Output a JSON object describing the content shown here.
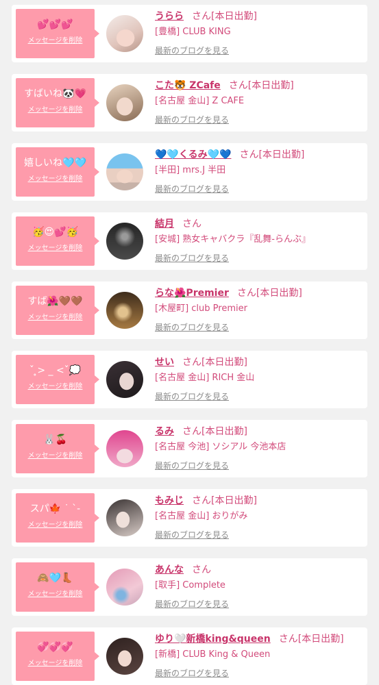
{
  "theme": {
    "page_bg": "#f1f1f1",
    "card_bg": "#ffffff",
    "bubble": "#fe9bab",
    "name": "#c8346a",
    "text_pink": "#d24a7a",
    "muted": "#8c8c8c"
  },
  "messages": [
    {
      "message": "💕💕💕",
      "delete_label": "メッセージを削除",
      "name": "うらら",
      "honorific": "さん",
      "status": "[本日出勤]",
      "store": "[豊橋] CLUB KING",
      "blog_link": "最新のブログを見る"
    },
    {
      "message": "すばいね🐼💗",
      "delete_label": "メッセージを削除",
      "name": "こた🐯 ZCafe",
      "honorific": "さん",
      "status": "[本日出勤]",
      "store": "[名古屋 金山] Z CAFE",
      "blog_link": "最新のブログを見る"
    },
    {
      "message": "嬉しいね🩵🩵",
      "delete_label": "メッセージを削除",
      "name": "💙🩵くるみ🩵💙",
      "honorific": "さん",
      "status": "[本日出勤]",
      "store": "[半田] mrs.J 半田",
      "blog_link": "最新のブログを見る"
    },
    {
      "message": "🥳😍💕🥳",
      "delete_label": "メッセージを削除",
      "name": "結月",
      "honorific": "さん",
      "store": "[安城] 熟女キャバクラ『乱舞-らんぶ』",
      "blog_link": "最新のブログを見る"
    },
    {
      "message": "すば🌺🤎🤎",
      "delete_label": "メッセージを削除",
      "name": "らな🌺Premier",
      "honorific": "さん",
      "status": "[本日出勤]",
      "store": "[木屋町] club Premier",
      "blog_link": "最新のブログを見る"
    },
    {
      "message": "ˇ ̥> _ <ˇ💭",
      "delete_label": "メッセージを削除",
      "name": "せい",
      "honorific": "さん",
      "status": "[本日出勤]",
      "store": "[名古屋 金山] RICH 金山",
      "blog_link": "最新のブログを見る"
    },
    {
      "message": "🐰🍒",
      "delete_label": "メッセージを削除",
      "name": "るみ",
      "honorific": "さん",
      "status": "[本日出勤]",
      "store": "[名古屋 今池] ソシアル 今池本店",
      "blog_link": "最新のブログを見る"
    },
    {
      "message": "スパ🍁 ˙ ˋ-",
      "delete_label": "メッセージを削除",
      "name": "もみじ",
      "honorific": "さん",
      "status": "[本日出勤]",
      "store": "[名古屋 金山] おりがみ",
      "blog_link": "最新のブログを見る"
    },
    {
      "message": "🙈🩵👢",
      "delete_label": "メッセージを削除",
      "name": "あんな",
      "honorific": "さん",
      "store": "[取手] Complete",
      "blog_link": "最新のブログを見る"
    },
    {
      "message": "💞💞💞",
      "delete_label": "メッセージを削除",
      "name": "ゆり🤍新橋king&queen",
      "honorific": "さん",
      "status": "[本日出勤]",
      "store": "[新橋] CLUB King & Queen",
      "blog_link": "最新のブログを見る"
    }
  ]
}
